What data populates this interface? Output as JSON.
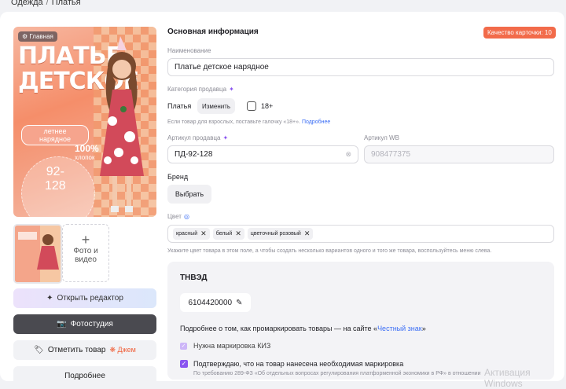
{
  "breadcrumb": {
    "item1": "Одежда",
    "sep": "/",
    "item2": "Платья"
  },
  "photo": {
    "main_badge": "Главная",
    "title_line1": "ПЛАТЬЕ",
    "title_line2": "ДЕТСКОЕ",
    "pill_line1": "летнее",
    "pill_line2": "нарядное",
    "percent": "100%",
    "percent_sub": "хлопок",
    "size1": "92-",
    "size2": "128",
    "add_photo_label": "Фото и видео"
  },
  "left_buttons": {
    "editor": "Открыть редактор",
    "studio": "Фотостудия",
    "mark": "Отметить товар",
    "mark_badge": "Джем",
    "more": "Подробнее"
  },
  "info": {
    "section_title": "Основная информация",
    "quality_badge": "Качество карточки: 10",
    "name_label": "Наименование",
    "name_value": "Платье детское нарядное",
    "category_label": "Категория продавца",
    "category_value": "Платья",
    "change_button": "Изменить",
    "adult_label": "18+",
    "adult_hint": "Если товар для взрослых, поставьте галочку «18+».",
    "adult_hint_link": "Подробнее",
    "seller_article_label": "Артикул продавца",
    "seller_article_value": "ПД-92-128",
    "wb_article_label": "Артикул WB",
    "wb_article_value": "908477375",
    "brand_label": "Бренд",
    "brand_button": "Выбрать",
    "color_label": "Цвет",
    "colors": [
      "красный",
      "белый",
      "цветочный розовый"
    ],
    "color_hint": "Укажите цвет товара в этом поле, а чтобы создать несколько вариантов одного и того же товара, воспользуйтесь меню слева."
  },
  "tnved": {
    "title": "ТНВЭД",
    "code": "6104420000",
    "marking_text": "Подробнее о том, как промаркировать товары — на сайте «",
    "marking_link": "Честный знак",
    "marking_end": "»",
    "kiz_label": "Нужна маркировка КИЗ",
    "confirm_label": "Подтверждаю, что на товар нанесена необходимая маркировка",
    "confirm_sub": "По требованию 289-ФЗ «Об отдельных вопросах регулирования платформенной экономики в РФ» в отношении"
  },
  "watermark": "Активация Windows",
  "colors": {
    "accent": "#8a55f0",
    "quality": "#f26b4a",
    "link": "#3b6ef5"
  }
}
